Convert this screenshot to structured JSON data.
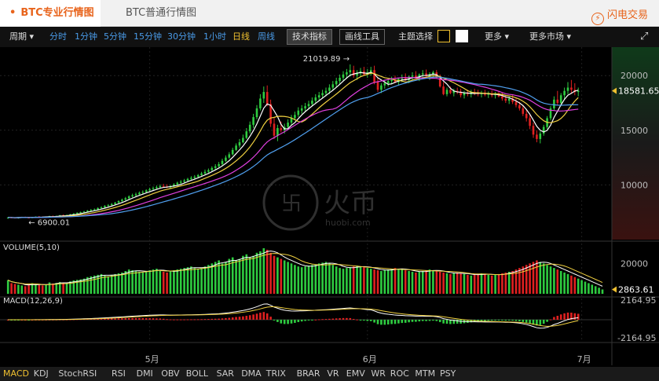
{
  "tabs": {
    "pro": "BTC专业行情图",
    "normal": "BTC普通行情图",
    "brand": "闪电交易"
  },
  "toolbar": {
    "period": "周期",
    "intervals": [
      "分时",
      "1分钟",
      "5分钟",
      "15分钟",
      "30分钟",
      "1小时",
      "日线",
      "周线"
    ],
    "active_interval": "日线",
    "tech": "技术指标",
    "draw": "画线工具",
    "theme": "主题选择",
    "more": "更多",
    "markets": "更多市场"
  },
  "colors": {
    "up": "#2ecc40",
    "down": "#e02020",
    "ma5": "#ffffff",
    "ma10": "#f0d040",
    "ma20": "#e040e0",
    "ma30": "#50a0f0",
    "accent": "#e8641c"
  },
  "watermark": {
    "brand": "火币",
    "url": "huobi.com"
  },
  "chart_data": {
    "type": "candlestick",
    "price_axis": {
      "ticks": [
        20000,
        15000,
        10000
      ],
      "ylim": [
        5000,
        22600
      ]
    },
    "annotations": {
      "high": "21019.89",
      "low": "6900.01",
      "last": "18581.65",
      "volume_last": "2863.61"
    },
    "volume": {
      "label": "VOLUME(5,10)",
      "ticks": [
        20000
      ],
      "ylim": [
        0,
        30000
      ]
    },
    "macd": {
      "label": "MACD(12,26,9)",
      "ticks": [
        "2164.95",
        "-2164.95"
      ],
      "ylim": [
        -2400,
        2400
      ]
    },
    "x_labels": [
      {
        "i": 41,
        "label": "5月"
      },
      {
        "i": 104,
        "label": "6月"
      },
      {
        "i": 166,
        "label": "7月"
      }
    ],
    "candles": [
      [
        7000,
        7050,
        6900,
        7020
      ],
      [
        7020,
        7080,
        6980,
        7010
      ],
      [
        7010,
        7060,
        6940,
        6990
      ],
      [
        6990,
        7050,
        6920,
        7030
      ],
      [
        7030,
        7090,
        7000,
        7060
      ],
      [
        7060,
        7100,
        6990,
        7010
      ],
      [
        7010,
        7050,
        6950,
        7000
      ],
      [
        7000,
        7080,
        6960,
        7040
      ],
      [
        7040,
        7120,
        7010,
        7100
      ],
      [
        7100,
        7150,
        7040,
        7080
      ],
      [
        7080,
        7130,
        7020,
        7060
      ],
      [
        7060,
        7110,
        7000,
        7090
      ],
      [
        7090,
        7180,
        7050,
        7150
      ],
      [
        7150,
        7200,
        7080,
        7110
      ],
      [
        7110,
        7190,
        7060,
        7170
      ],
      [
        7170,
        7260,
        7130,
        7220
      ],
      [
        7220,
        7300,
        7150,
        7190
      ],
      [
        7190,
        7280,
        7120,
        7250
      ],
      [
        7250,
        7350,
        7200,
        7300
      ],
      [
        7300,
        7420,
        7250,
        7380
      ],
      [
        7380,
        7500,
        7320,
        7450
      ],
      [
        7450,
        7560,
        7400,
        7500
      ],
      [
        7500,
        7620,
        7440,
        7560
      ],
      [
        7560,
        7700,
        7500,
        7650
      ],
      [
        7650,
        7800,
        7580,
        7700
      ],
      [
        7700,
        7850,
        7620,
        7760
      ],
      [
        7760,
        7950,
        7700,
        7880
      ],
      [
        7880,
        8050,
        7800,
        7950
      ],
      [
        7950,
        8150,
        7880,
        8080
      ],
      [
        8080,
        8250,
        8000,
        8150
      ],
      [
        8150,
        8350,
        8050,
        8250
      ],
      [
        8250,
        8450,
        8180,
        8380
      ],
      [
        8380,
        8600,
        8300,
        8520
      ],
      [
        8520,
        8750,
        8400,
        8650
      ],
      [
        8650,
        8900,
        8550,
        8780
      ],
      [
        8780,
        9050,
        8700,
        8950
      ],
      [
        8950,
        9200,
        8850,
        9050
      ],
      [
        9050,
        9300,
        8950,
        9150
      ],
      [
        9150,
        9400,
        9050,
        9280
      ],
      [
        9280,
        9500,
        9150,
        9350
      ],
      [
        9350,
        9600,
        9250,
        9500
      ],
      [
        9500,
        9750,
        9400,
        9620
      ],
      [
        9620,
        9850,
        9500,
        9700
      ],
      [
        9700,
        9950,
        9600,
        9800
      ],
      [
        9800,
        10050,
        9700,
        9900
      ],
      [
        9900,
        10100,
        9750,
        9850
      ],
      [
        9850,
        10050,
        9700,
        9780
      ],
      [
        9780,
        10000,
        9650,
        9900
      ],
      [
        9900,
        10150,
        9800,
        10050
      ],
      [
        10050,
        10300,
        9950,
        10200
      ],
      [
        10200,
        10450,
        10100,
        10300
      ],
      [
        10300,
        10550,
        10200,
        10400
      ],
      [
        10400,
        10650,
        10300,
        10550
      ],
      [
        10550,
        10800,
        10400,
        10650
      ],
      [
        10650,
        10900,
        10500,
        10750
      ],
      [
        10750,
        11000,
        10600,
        10900
      ],
      [
        10900,
        11200,
        10800,
        11050
      ],
      [
        11050,
        11400,
        10950,
        11200
      ],
      [
        11200,
        11500,
        11100,
        11350
      ],
      [
        11350,
        11700,
        11250,
        11550
      ],
      [
        11550,
        11900,
        11400,
        11700
      ],
      [
        11700,
        12100,
        11600,
        11900
      ],
      [
        11900,
        12400,
        11800,
        12200
      ],
      [
        12200,
        12700,
        12100,
        12500
      ],
      [
        12500,
        13000,
        12400,
        12800
      ],
      [
        12800,
        13400,
        12700,
        13200
      ],
      [
        13200,
        13800,
        13100,
        13600
      ],
      [
        13600,
        14200,
        13400,
        13900
      ],
      [
        13900,
        14600,
        13800,
        14300
      ],
      [
        14300,
        15200,
        14200,
        14900
      ],
      [
        14900,
        15800,
        14700,
        15500
      ],
      [
        15500,
        16500,
        15200,
        16200
      ],
      [
        16200,
        17300,
        16000,
        17000
      ],
      [
        17000,
        18300,
        16800,
        17900
      ],
      [
        17900,
        19000,
        17500,
        18500
      ],
      [
        18500,
        19100,
        17200,
        17400
      ],
      [
        17400,
        17800,
        15300,
        15600
      ],
      [
        15600,
        16200,
        14200,
        14500
      ],
      [
        14500,
        15500,
        14000,
        15200
      ],
      [
        15200,
        15800,
        14800,
        15000
      ],
      [
        15000,
        15600,
        14700,
        15300
      ],
      [
        15300,
        16000,
        15100,
        15700
      ],
      [
        15700,
        16400,
        15500,
        16100
      ],
      [
        16100,
        16700,
        15900,
        16400
      ],
      [
        16400,
        17100,
        16200,
        16800
      ],
      [
        16800,
        17300,
        16500,
        17000
      ],
      [
        17000,
        17500,
        16700,
        17200
      ],
      [
        17200,
        17700,
        16900,
        17400
      ],
      [
        17400,
        18000,
        17200,
        17700
      ],
      [
        17700,
        18300,
        17500,
        18000
      ],
      [
        18000,
        18500,
        17700,
        18200
      ],
      [
        18200,
        18700,
        17900,
        18400
      ],
      [
        18400,
        18900,
        18100,
        18600
      ],
      [
        18600,
        19200,
        18300,
        18900
      ],
      [
        18900,
        19500,
        18700,
        19200
      ],
      [
        19200,
        19800,
        18900,
        19500
      ],
      [
        19500,
        20100,
        19200,
        19800
      ],
      [
        19800,
        20400,
        19500,
        20100
      ],
      [
        20100,
        20600,
        19700,
        20300
      ],
      [
        20300,
        21019,
        19900,
        20500
      ],
      [
        20500,
        20900,
        19800,
        20000
      ],
      [
        20000,
        20500,
        19600,
        20200
      ],
      [
        20200,
        20700,
        19900,
        20400
      ],
      [
        20400,
        20800,
        20000,
        20100
      ],
      [
        20100,
        20600,
        19800,
        20300
      ],
      [
        20300,
        20800,
        20000,
        20500
      ],
      [
        20500,
        20900,
        19200,
        19400
      ],
      [
        19400,
        19800,
        18500,
        18700
      ],
      [
        18700,
        19300,
        18400,
        19100
      ],
      [
        19100,
        19600,
        18800,
        19300
      ],
      [
        19300,
        19700,
        19000,
        19500
      ],
      [
        19500,
        19900,
        19200,
        19600
      ],
      [
        19600,
        20000,
        19300,
        19400
      ],
      [
        19400,
        19800,
        19100,
        19700
      ],
      [
        19700,
        20100,
        19400,
        19800
      ],
      [
        19800,
        20200,
        19500,
        19600
      ],
      [
        19600,
        20000,
        19300,
        19900
      ],
      [
        19900,
        20300,
        19600,
        20000
      ],
      [
        20000,
        20400,
        19700,
        19800
      ],
      [
        19800,
        20200,
        19500,
        20100
      ],
      [
        20100,
        20500,
        19800,
        20200
      ],
      [
        20200,
        20550,
        19900,
        19950
      ],
      [
        19950,
        20300,
        19600,
        20150
      ],
      [
        20150,
        20450,
        19850,
        20300
      ],
      [
        20300,
        20500,
        19700,
        19800
      ],
      [
        19800,
        20100,
        18900,
        19000
      ],
      [
        19000,
        19400,
        18200,
        18300
      ],
      [
        18300,
        18900,
        18100,
        18700
      ],
      [
        18700,
        19000,
        18300,
        18400
      ],
      [
        18400,
        18800,
        18100,
        18600
      ],
      [
        18600,
        18900,
        18300,
        18500
      ],
      [
        18500,
        18800,
        18000,
        18200
      ],
      [
        18200,
        18600,
        17900,
        18400
      ],
      [
        18400,
        18700,
        18100,
        18300
      ],
      [
        18300,
        18700,
        18000,
        18500
      ],
      [
        18500,
        18800,
        18200,
        18400
      ],
      [
        18400,
        18700,
        18100,
        18300
      ],
      [
        18300,
        18600,
        18000,
        18400
      ],
      [
        18400,
        18700,
        18100,
        18250
      ],
      [
        18250,
        18550,
        17950,
        18350
      ],
      [
        18350,
        18650,
        18000,
        18200
      ],
      [
        18200,
        18500,
        17900,
        18300
      ],
      [
        18300,
        18600,
        18000,
        18100
      ],
      [
        18100,
        18400,
        17700,
        17900
      ],
      [
        17900,
        18200,
        17500,
        17700
      ],
      [
        17700,
        18100,
        17400,
        17900
      ],
      [
        17900,
        18200,
        17400,
        17600
      ],
      [
        17600,
        17900,
        17100,
        17300
      ],
      [
        17300,
        17600,
        16800,
        17000
      ],
      [
        17000,
        17300,
        16300,
        16500
      ],
      [
        16500,
        16900,
        15800,
        16100
      ],
      [
        16100,
        16400,
        15100,
        15400
      ],
      [
        15400,
        15700,
        14300,
        14600
      ],
      [
        14600,
        15000,
        13900,
        14200
      ],
      [
        14200,
        14900,
        13800,
        14700
      ],
      [
        14700,
        15500,
        14500,
        15300
      ],
      [
        15300,
        16300,
        15100,
        16100
      ],
      [
        16100,
        17200,
        15900,
        17000
      ],
      [
        17000,
        18100,
        16800,
        17800
      ],
      [
        17800,
        18600,
        17300,
        17500
      ],
      [
        17500,
        18400,
        17200,
        18200
      ],
      [
        18200,
        18900,
        17800,
        18600
      ],
      [
        18600,
        19400,
        18300,
        18900
      ],
      [
        18900,
        19600,
        18400,
        18700
      ],
      [
        18700,
        19300,
        18200,
        18500
      ],
      [
        18500,
        18900,
        18100,
        18600
      ]
    ],
    "volume_values": [
      9000,
      7000,
      6500,
      6000,
      5500,
      5000,
      6500,
      7000,
      6000,
      5800,
      5500,
      6200,
      7500,
      6800,
      7200,
      7800,
      7000,
      7400,
      8200,
      8800,
      9200,
      9500,
      10000,
      11000,
      11500,
      12000,
      12500,
      13000,
      12000,
      11500,
      12500,
      13000,
      13500,
      14000,
      15000,
      16000,
      15500,
      15000,
      14500,
      14000,
      15000,
      15500,
      16000,
      16500,
      15000,
      14500,
      14000,
      15000,
      15500,
      16000,
      16500,
      17000,
      17500,
      18000,
      17000,
      16500,
      17000,
      18000,
      19000,
      20000,
      21000,
      22000,
      20000,
      21000,
      23000,
      24000,
      22000,
      23000,
      25000,
      26000,
      24000,
      25000,
      27000,
      28000,
      30000,
      29000,
      27000,
      25000,
      24000,
      23000,
      22000,
      21000,
      20000,
      19000,
      18000,
      17500,
      18000,
      18500,
      19000,
      19500,
      20000,
      20500,
      21000,
      20000,
      19000,
      18000,
      17000,
      16500,
      17000,
      17500,
      18000,
      18500,
      18000,
      17500,
      17000,
      16500,
      16000,
      15500,
      15000,
      15500,
      16000,
      16500,
      17000,
      16500,
      16000,
      15500,
      15000,
      14500,
      14000,
      14500,
      15000,
      15500,
      16000,
      15500,
      15000,
      14500,
      14000,
      13500,
      13000,
      13500,
      14000,
      13500,
      13000,
      12500,
      12000,
      12500,
      13000,
      13500,
      13000,
      12500,
      12000,
      12500,
      13000,
      13500,
      14000,
      14500,
      15000,
      16000,
      17000,
      18000,
      19000,
      20000,
      21000,
      22000,
      21000,
      20000,
      19000,
      18000,
      17000,
      16000,
      15000,
      14000,
      13000,
      12000,
      11000,
      10000,
      9000,
      8000,
      7000,
      6000,
      5000,
      4000,
      2863.61
    ]
  },
  "bottom_indicators": [
    "MACD",
    "KDJ",
    "StochRSI",
    "RSI",
    "DMI",
    "OBV",
    "BOLL",
    "SAR",
    "DMA",
    "TRIX",
    "BRAR",
    "VR",
    "EMV",
    "WR",
    "ROC",
    "MTM",
    "PSY"
  ]
}
